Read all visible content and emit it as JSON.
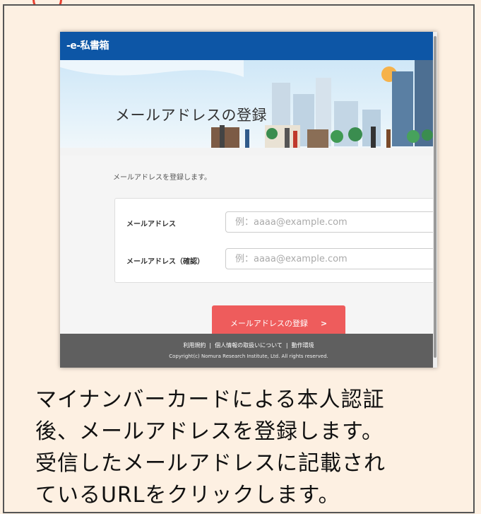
{
  "header": {
    "logo": "-e-私書箱"
  },
  "banner": {
    "title": "メールアドレスの登録"
  },
  "content": {
    "intro": "メールアドレスを登録します。",
    "form": {
      "email_label": "メールアドレス",
      "email_placeholder": "例：aaaa@example.com",
      "email_confirm_label": "メールアドレス（確認）",
      "email_confirm_placeholder": "例：aaaa@example.com"
    },
    "submit": {
      "label": "メールアドレスの登録",
      "chevron": ">"
    }
  },
  "footer": {
    "links": [
      "利用規約",
      "個人情報の取扱いについて",
      "動作環境"
    ],
    "separator": "|",
    "copyright": "Copyright(c) Nomura Research Institute, Ltd. All rights reserved."
  },
  "caption": {
    "lines": [
      "マイナンバーカードによる本人認証",
      "後、メールアドレスを登録します。",
      "受信したメールアドレスに記載され",
      "ているURLをクリックします。"
    ]
  },
  "colors": {
    "header": "#0d56a6",
    "submit": "#ee5c5c",
    "footer": "#5f5f5f",
    "page_background": "#fdf0e2",
    "step_badge": "#e8402f"
  },
  "icons": [
    "chevron-right-icon"
  ]
}
